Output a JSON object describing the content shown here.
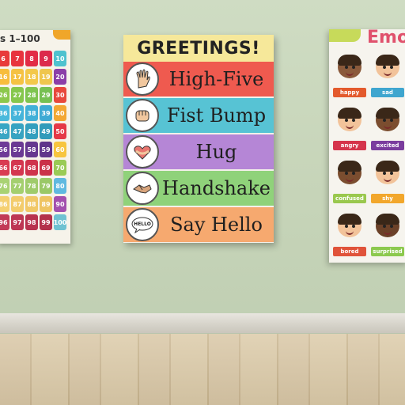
{
  "numbers_poster": {
    "title": "s 1–100",
    "cells": [
      {
        "n": "6",
        "c": "#e83a3a"
      },
      {
        "n": "7",
        "c": "#e8333e"
      },
      {
        "n": "8",
        "c": "#e22c46"
      },
      {
        "n": "9",
        "c": "#dc2a4c"
      },
      {
        "n": "10",
        "c": "#4fc2cf"
      },
      {
        "n": "16",
        "c": "#f7bd3c"
      },
      {
        "n": "17",
        "c": "#f5c243"
      },
      {
        "n": "18",
        "c": "#f3c84a"
      },
      {
        "n": "19",
        "c": "#efc64d"
      },
      {
        "n": "20",
        "c": "#8b3ea8"
      },
      {
        "n": "26",
        "c": "#8cc84b"
      },
      {
        "n": "27",
        "c": "#86c74c"
      },
      {
        "n": "28",
        "c": "#7fc44f"
      },
      {
        "n": "29",
        "c": "#76c052"
      },
      {
        "n": "30",
        "c": "#e8483c"
      },
      {
        "n": "36",
        "c": "#4ab9dc"
      },
      {
        "n": "37",
        "c": "#45b4da"
      },
      {
        "n": "38",
        "c": "#41b0d8"
      },
      {
        "n": "39",
        "c": "#3eaad4"
      },
      {
        "n": "40",
        "c": "#f3a733"
      },
      {
        "n": "46",
        "c": "#3aa6c4"
      },
      {
        "n": "47",
        "c": "#37a3c1"
      },
      {
        "n": "48",
        "c": "#349fbe"
      },
      {
        "n": "49",
        "c": "#319bba"
      },
      {
        "n": "50",
        "c": "#e53947"
      },
      {
        "n": "56",
        "c": "#6f3b97"
      },
      {
        "n": "57",
        "c": "#6a3993"
      },
      {
        "n": "58",
        "c": "#65378f"
      },
      {
        "n": "59",
        "c": "#60358b"
      },
      {
        "n": "60",
        "c": "#f7c53f"
      },
      {
        "n": "66",
        "c": "#d93b52"
      },
      {
        "n": "67",
        "c": "#d4374f"
      },
      {
        "n": "68",
        "c": "#cf344c"
      },
      {
        "n": "69",
        "c": "#ca3149"
      },
      {
        "n": "70",
        "c": "#9acb55"
      },
      {
        "n": "76",
        "c": "#a9d273"
      },
      {
        "n": "77",
        "c": "#a4cf6f"
      },
      {
        "n": "78",
        "c": "#9fcb6b"
      },
      {
        "n": "79",
        "c": "#9ac867"
      },
      {
        "n": "80",
        "c": "#5fb9e0"
      },
      {
        "n": "86",
        "c": "#f5d071"
      },
      {
        "n": "87",
        "c": "#f3cc6c"
      },
      {
        "n": "88",
        "c": "#f1c867"
      },
      {
        "n": "89",
        "c": "#efc462"
      },
      {
        "n": "90",
        "c": "#a34fae"
      },
      {
        "n": "96",
        "c": "#c23a57"
      },
      {
        "n": "97",
        "c": "#bd3653"
      },
      {
        "n": "98",
        "c": "#b8334f"
      },
      {
        "n": "99",
        "c": "#b3304b"
      },
      {
        "n": "100",
        "c": "#6fc2d2"
      }
    ]
  },
  "greetings_poster": {
    "title": "GREETINGS!",
    "rows": [
      {
        "label": "High-Five",
        "color": "#ef5a4f",
        "icon": "hand-icon"
      },
      {
        "label": "Fist Bump",
        "color": "#57c3d4",
        "icon": "fist-icon"
      },
      {
        "label": "Hug",
        "color": "#b586d6",
        "icon": "hug-icon"
      },
      {
        "label": "Handshake",
        "color": "#8fd27a",
        "icon": "handshake-icon"
      },
      {
        "label": "Say Hello",
        "color": "#f6a96f",
        "icon": "speech-bubble-icon",
        "bubble_text": "HELLO"
      }
    ]
  },
  "emotions_poster": {
    "title": "Emo",
    "faces": [
      {
        "label": "happy",
        "tag_color": "#e35a2c",
        "skin": "#8a5a3b"
      },
      {
        "label": "sad",
        "tag_color": "#3fa6cf",
        "skin": "#f2c39a"
      },
      {
        "label": "angry",
        "tag_color": "#d5344b",
        "skin": "#f2c39a"
      },
      {
        "label": "excited",
        "tag_color": "#7a3d9e",
        "skin": "#7b4d2f"
      },
      {
        "label": "confused",
        "tag_color": "#9ac84e",
        "skin": "#7b4d2f"
      },
      {
        "label": "shy",
        "tag_color": "#f2a72c",
        "skin": "#f2c39a"
      },
      {
        "label": "bored",
        "tag_color": "#e0533a",
        "skin": "#f2c39a"
      },
      {
        "label": "surprised",
        "tag_color": "#8cc94e",
        "skin": "#6b4128"
      }
    ]
  }
}
